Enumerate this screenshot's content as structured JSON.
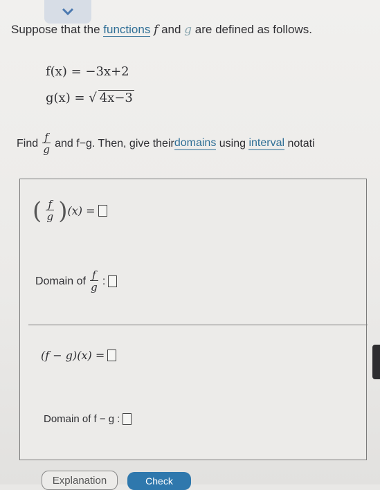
{
  "prompt": {
    "before": "Suppose that the ",
    "link": "functions",
    "f": "f",
    "and": " and ",
    "g": "g",
    "after": " are defined as follows."
  },
  "equations": {
    "f": "f(x) = −3x+2",
    "g_left": "g(x) = ",
    "g_radicand": "4x−3"
  },
  "instruction": {
    "find": "Find",
    "frac_num": "f",
    "frac_den": "g",
    "middle": "and f−g. Then, give their ",
    "link1": "domains",
    "using": " using ",
    "link2": "interval",
    "end": " notati"
  },
  "answers": {
    "q1_rhs": "(x) =",
    "domain1_label": "Domain of",
    "domain1_suffix": ":",
    "q3_expr": "(f − g)(x) =",
    "domain2_label": "Domain of f − g :"
  },
  "buttons": {
    "explanation": "Explanation",
    "check": "Check"
  }
}
